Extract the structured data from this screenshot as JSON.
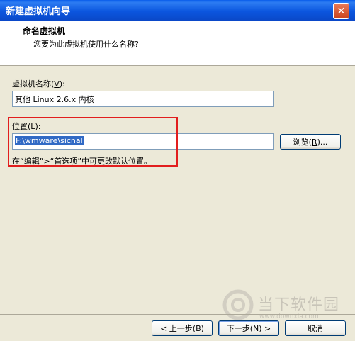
{
  "window": {
    "title": "新建虚拟机向导",
    "close_symbol": "✕"
  },
  "header": {
    "title": "命名虚拟机",
    "subtitle": "您要为此虚拟机使用什么名称?"
  },
  "vm_name": {
    "label_prefix": "虚拟机名称(",
    "label_key": "V",
    "label_suffix": "):",
    "value": "其他 Linux 2.6.x 内核"
  },
  "location": {
    "label_prefix": "位置(",
    "label_key": "L",
    "label_suffix": "):",
    "value": "F:\\wmware\\sicnal",
    "browse_prefix": "浏览(",
    "browse_key": "R",
    "browse_suffix": ")..."
  },
  "hint": "在“编辑”>“首选项”中可更改默认位置。",
  "footer": {
    "back_prefix": "< 上一步(",
    "back_key": "B",
    "back_suffix": ")",
    "next_prefix": "下一步(",
    "next_key": "N",
    "next_suffix": ") >",
    "cancel": "取消"
  },
  "watermark": {
    "text": "当下软件园",
    "url": "www.downxia.com"
  }
}
